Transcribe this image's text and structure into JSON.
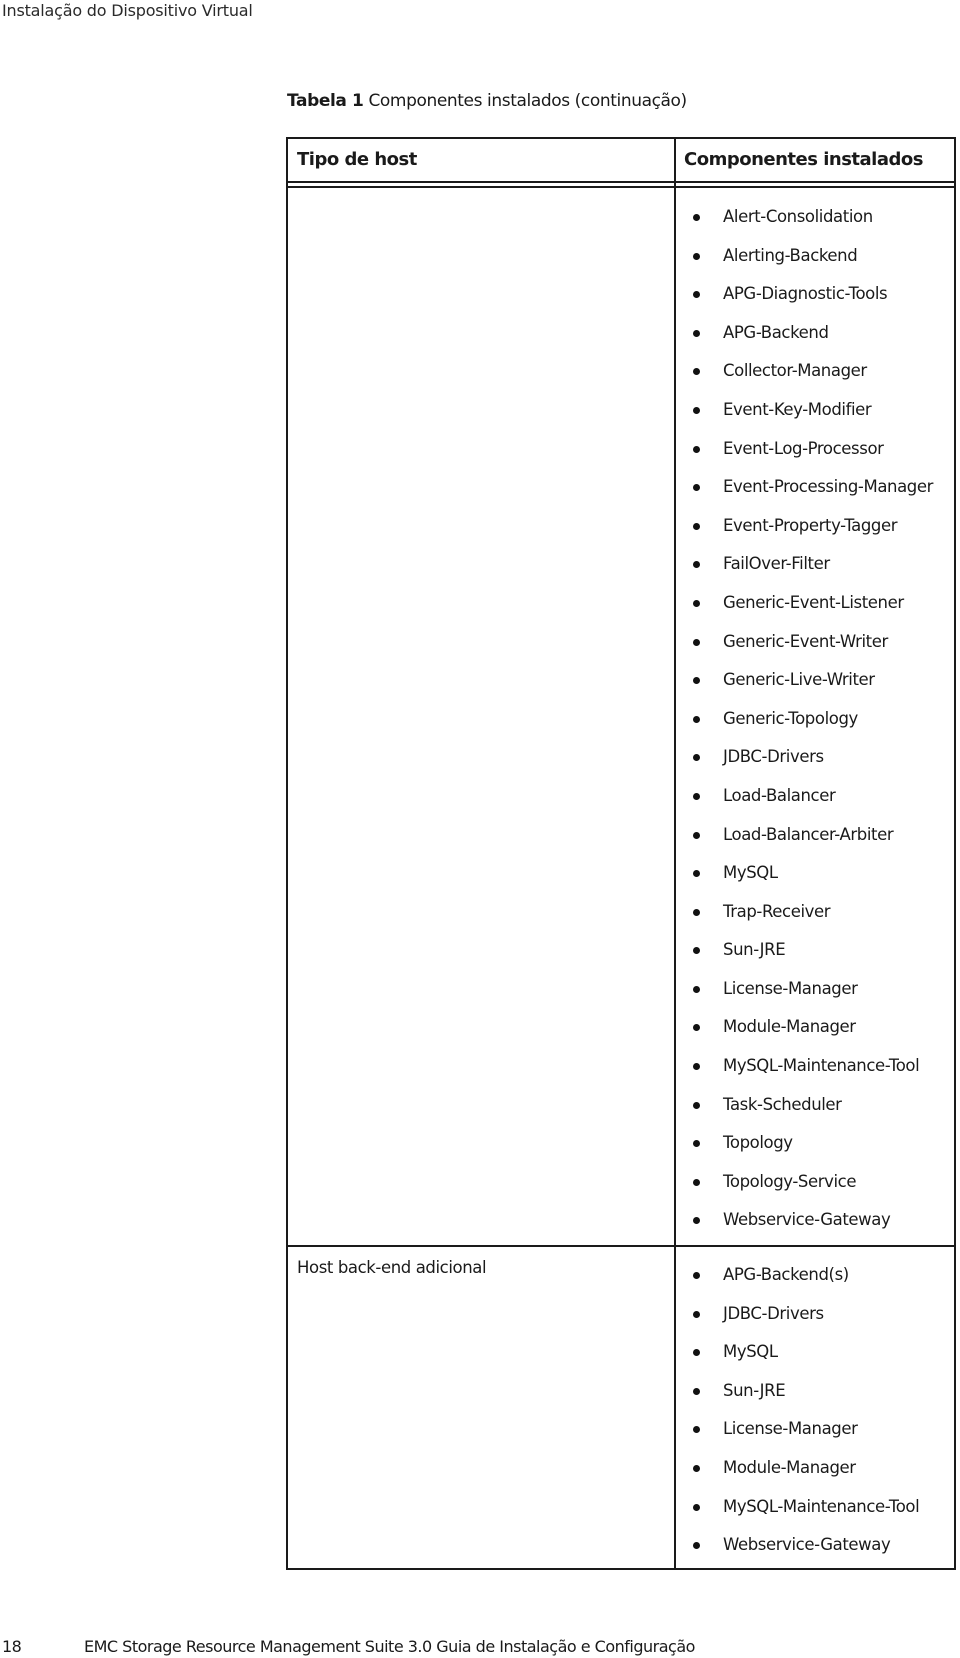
{
  "running_header": "Instalação do Dispositivo Virtual",
  "table": {
    "caption_label": "Tabela 1",
    "caption_text": "Componentes instalados (continuação)",
    "headers": {
      "host_type": "Tipo de host",
      "components": "Componentes instalados"
    },
    "rows": [
      {
        "host_type": "",
        "components": [
          "Alert-Consolidation",
          "Alerting-Backend",
          "APG-Diagnostic-Tools",
          "APG-Backend",
          "Collector-Manager",
          "Event-Key-Modifier",
          "Event-Log-Processor",
          "Event-Processing-Manager",
          "Event-Property-Tagger",
          "FailOver-Filter",
          "Generic-Event-Listener",
          "Generic-Event-Writer",
          "Generic-Live-Writer",
          "Generic-Topology",
          "JDBC-Drivers",
          "Load-Balancer",
          "Load-Balancer-Arbiter",
          "MySQL",
          "Trap-Receiver",
          "Sun-JRE",
          "License-Manager",
          "Module-Manager",
          "MySQL-Maintenance-Tool",
          "Task-Scheduler",
          "Topology",
          "Topology-Service",
          "Webservice-Gateway"
        ]
      },
      {
        "host_type": "Host back-end adicional",
        "components": [
          "APG-Backend(s)",
          "JDBC-Drivers",
          "MySQL",
          "Sun-JRE",
          "License-Manager",
          "Module-Manager",
          "MySQL-Maintenance-Tool",
          "Webservice-Gateway"
        ]
      }
    ]
  },
  "footer": {
    "page_number": "18",
    "title": "EMC Storage Resource Management Suite 3.0  Guia de Instalação e Configuração"
  }
}
